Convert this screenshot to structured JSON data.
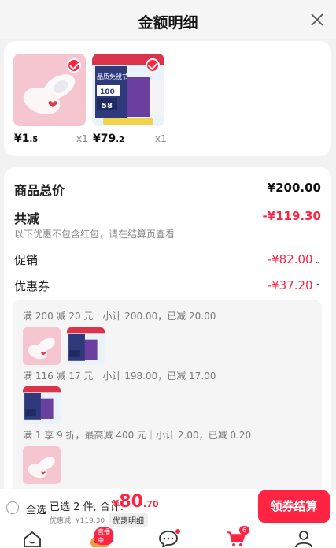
{
  "header": {
    "title": "金额明细"
  },
  "items": [
    {
      "price_main": "¥1",
      "price_dec": ".5",
      "qty": "x1"
    },
    {
      "price_main": "¥79",
      "price_dec": ".2",
      "qty": "x1"
    }
  ],
  "product2_text": {
    "line1": "品质免税节",
    "line2": "100",
    "line3": "58"
  },
  "summary": {
    "total_label": "商品总价",
    "total_value": "¥200.00",
    "reduce_label": "共减",
    "reduce_value": "-¥119.30",
    "reduce_note": "以下优惠不包含红包，请在结算页查看",
    "promo_label": "促销",
    "promo_value": "-¥82.00",
    "coupon_label": "优惠券",
    "coupon_value": "-¥37.20"
  },
  "coupon_details": [
    "满 200 减 20 元｜小计 200.00，已减 20.00",
    "满 116 减 17 元｜小计 198.00，已减 17.00",
    "满 1 享 9 折，最高减 400 元｜小计 2.00，已减 0.20"
  ],
  "bottom": {
    "select_all": "全选",
    "selected": "已选 2 件, 合计:",
    "yen": "¥",
    "total_int": "80",
    "total_dec": ".70",
    "discount": "优惠减: ¥119.30",
    "detail_link": "优惠明细",
    "checkout": "领券结算"
  },
  "tabbar": {
    "live_badge": "直播中",
    "cart_count": "6"
  },
  "colors": {
    "accent": "#ff2442",
    "background": "#f2f2f2"
  }
}
